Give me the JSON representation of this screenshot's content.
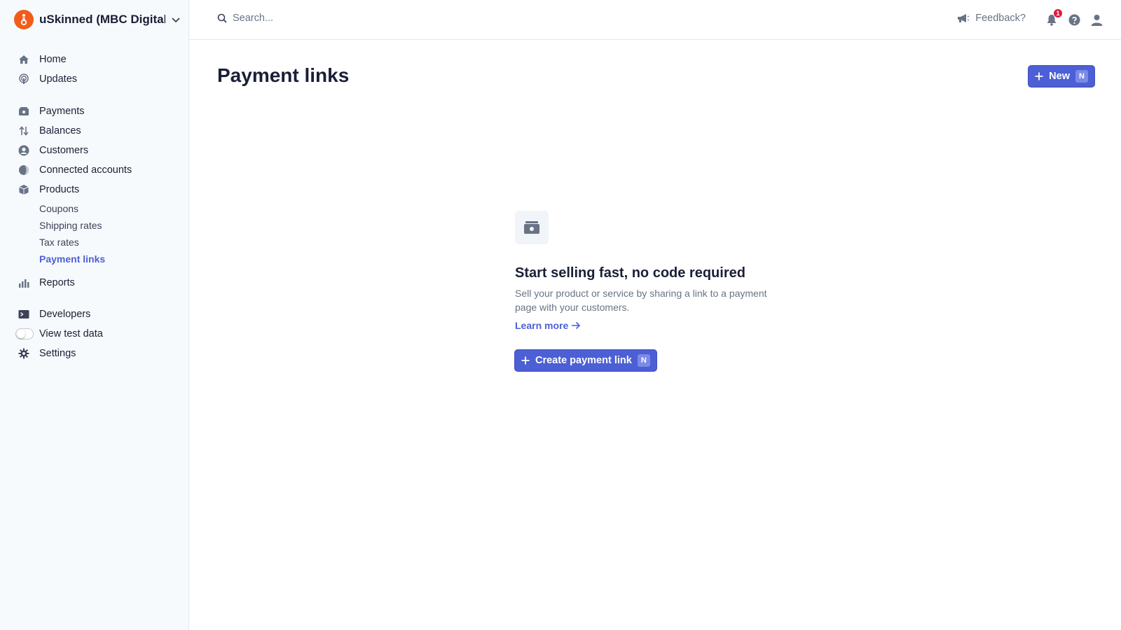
{
  "account": {
    "name": "uSkinned (MBC Digital...",
    "logo_color": "#f25c1b"
  },
  "sidebar": {
    "items": [
      {
        "label": "Home",
        "icon": "home-icon"
      },
      {
        "label": "Updates",
        "icon": "broadcast-icon"
      },
      {
        "label": "Payments",
        "icon": "payments-icon"
      },
      {
        "label": "Balances",
        "icon": "balances-icon"
      },
      {
        "label": "Customers",
        "icon": "customer-icon"
      },
      {
        "label": "Connected accounts",
        "icon": "globe-icon"
      },
      {
        "label": "Products",
        "icon": "box-icon"
      },
      {
        "label": "Reports",
        "icon": "reports-icon"
      },
      {
        "label": "Developers",
        "icon": "terminal-icon"
      },
      {
        "label": "View test data",
        "icon": "toggle"
      },
      {
        "label": "Settings",
        "icon": "gear-icon"
      }
    ],
    "subitems": [
      {
        "label": "Coupons"
      },
      {
        "label": "Shipping rates"
      },
      {
        "label": "Tax rates"
      },
      {
        "label": "Payment links",
        "active": true
      }
    ]
  },
  "topbar": {
    "search_placeholder": "Search...",
    "feedback_label": "Feedback?",
    "notification_count": "1"
  },
  "main": {
    "title": "Payment links",
    "new_button_label": "New",
    "new_button_shortcut": "N",
    "empty_state": {
      "title": "Start selling fast, no code required",
      "description": "Sell your product or service by sharing a link to a payment page with your customers.",
      "learn_more_label": "Learn more",
      "create_button_label": "Create payment link",
      "create_button_shortcut": "N"
    }
  },
  "colors": {
    "accent": "#4c5fd5",
    "badge": "#df1b41",
    "sidebar_bg": "#f7fafc"
  }
}
